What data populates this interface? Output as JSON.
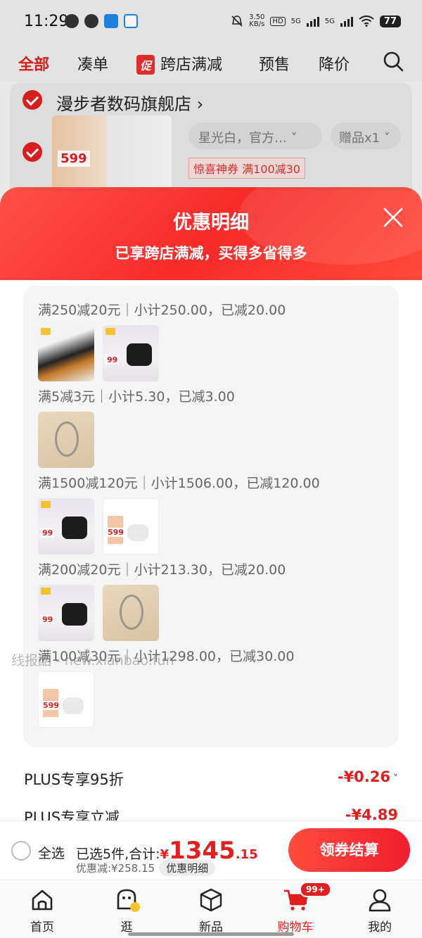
{
  "status_bar": {
    "time": "11:29",
    "net_speed_top": "3.50",
    "net_speed_bottom": "KB/s",
    "hd": "HD",
    "net1": "5G",
    "net2": "5G",
    "battery": "77"
  },
  "top_tabs": {
    "items": [
      "全部",
      "凑单",
      "跨店满减",
      "预售",
      "降价"
    ],
    "promo_badge": "促",
    "active_index": 0
  },
  "store": {
    "name": "漫步者数码旗舰店",
    "name_arrow": "›",
    "thumb_price": "599",
    "sku": "星光白，官方…",
    "gift": "赠品x1",
    "coupon": "惊喜神券 满100减30"
  },
  "sheet": {
    "title": "优惠明细",
    "subtitle": "已享跨店满减，买得多省得多"
  },
  "tiers": [
    {
      "label": "满250减20元｜小计250.00，已减20.00",
      "products": [
        "cable",
        "earbuds-black"
      ]
    },
    {
      "label": "满5减3元｜小计5.30，已减3.00",
      "products": [
        "scissors"
      ]
    },
    {
      "label": "满1500减120元｜小计1506.00，已减120.00",
      "products": [
        "earbuds-black",
        "earbuds-white"
      ]
    },
    {
      "label": "满200减20元｜小计213.30，已减20.00",
      "products": [
        "earbuds-black",
        "scissors"
      ]
    },
    {
      "label": "满100减30元｜小计1298.00，已减30.00",
      "products": [
        "earbuds-white"
      ]
    }
  ],
  "thumb_prices": {
    "earbuds-black": "99",
    "earbuds-white": "599"
  },
  "watermark": "线报酷 - new.xianbao.fun",
  "plus_rows": [
    {
      "label": "PLUS专享95折",
      "amount": "-¥0.26",
      "chevron": "˅"
    },
    {
      "label": "PLUS专享立减",
      "amount": "-¥4.89"
    }
  ],
  "checkout": {
    "select_all": "全选",
    "summary_prefix": "已选5件,合计:",
    "currency": "¥",
    "total_int": "1345",
    "total_dec": ".15",
    "discount_text": "优惠减:¥258.15",
    "detail_button": "优惠明细",
    "settle_button": "领券结算"
  },
  "bottom_nav": {
    "items": [
      "首页",
      "逛",
      "新品",
      "购物车",
      "我的"
    ],
    "active_index": 3,
    "cart_badge": "99+"
  },
  "colors": {
    "accent": "#e02020",
    "header_gradient_start": "#ff5147",
    "header_gradient_end": "#f72b29"
  }
}
